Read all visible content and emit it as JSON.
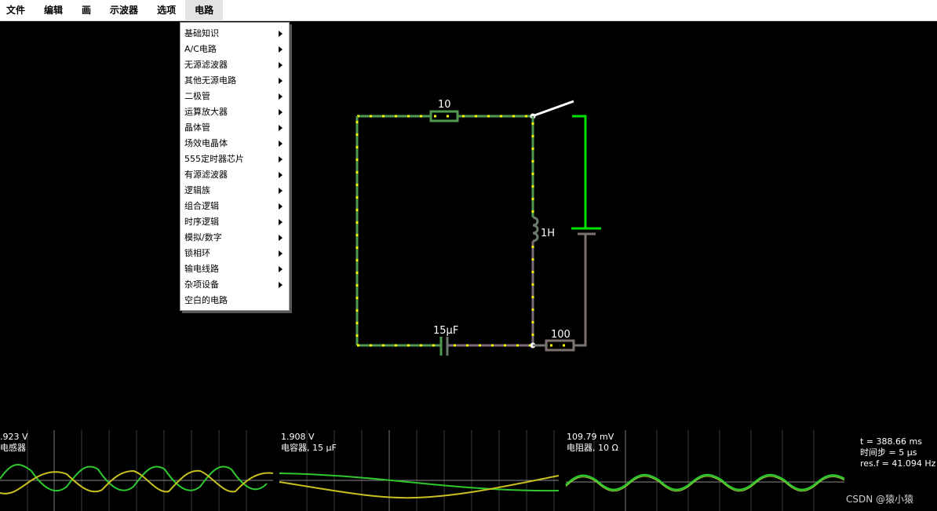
{
  "menu": {
    "items": [
      "文件",
      "编辑",
      "画",
      "示波器",
      "选项",
      "电路"
    ],
    "open_index": 5
  },
  "circuit_menu": {
    "items": [
      {
        "label": "基础知识",
        "submenu": true
      },
      {
        "label": "A/C电路",
        "submenu": true
      },
      {
        "label": "无源滤波器",
        "submenu": true
      },
      {
        "label": "其他无源电路",
        "submenu": true
      },
      {
        "label": "二极管",
        "submenu": true
      },
      {
        "label": "运算放大器",
        "submenu": true
      },
      {
        "label": "晶体管",
        "submenu": true
      },
      {
        "label": "场效电晶体",
        "submenu": true
      },
      {
        "label": "555定时器芯片",
        "submenu": true
      },
      {
        "label": "有源滤波器",
        "submenu": true
      },
      {
        "label": "逻辑族",
        "submenu": true
      },
      {
        "label": "组合逻辑",
        "submenu": true
      },
      {
        "label": "时序逻辑",
        "submenu": true
      },
      {
        "label": "模拟/数字",
        "submenu": true
      },
      {
        "label": "锁相环",
        "submenu": true
      },
      {
        "label": "输电线路",
        "submenu": true
      },
      {
        "label": "杂项设备",
        "submenu": true
      },
      {
        "label": "空白的电路",
        "submenu": false
      }
    ]
  },
  "circuit": {
    "resistor_top": "10",
    "inductor": "1H",
    "capacitor": "15μF",
    "resistor_bottom": "100"
  },
  "scopes": [
    {
      "value": ".923 V",
      "label": "电感器"
    },
    {
      "value": "1.908 V",
      "label": "电容器, 15 μF"
    },
    {
      "value": "109.79 mV",
      "label": "电阻器, 10 Ω"
    }
  ],
  "sim_info": {
    "time": "t = 388.66 ms",
    "timestep": "时间步 = 5 μs",
    "resf": "res.f = 41.094 Hz"
  },
  "watermark": "CSDN @猿小猿",
  "colors": {
    "wire_current": "#ffff00",
    "wire": "#4f9a4f",
    "switch_green": "#00e000",
    "trace_green": "#2ec82e",
    "trace_yellow": "#c8c020",
    "grid": "#555555"
  }
}
